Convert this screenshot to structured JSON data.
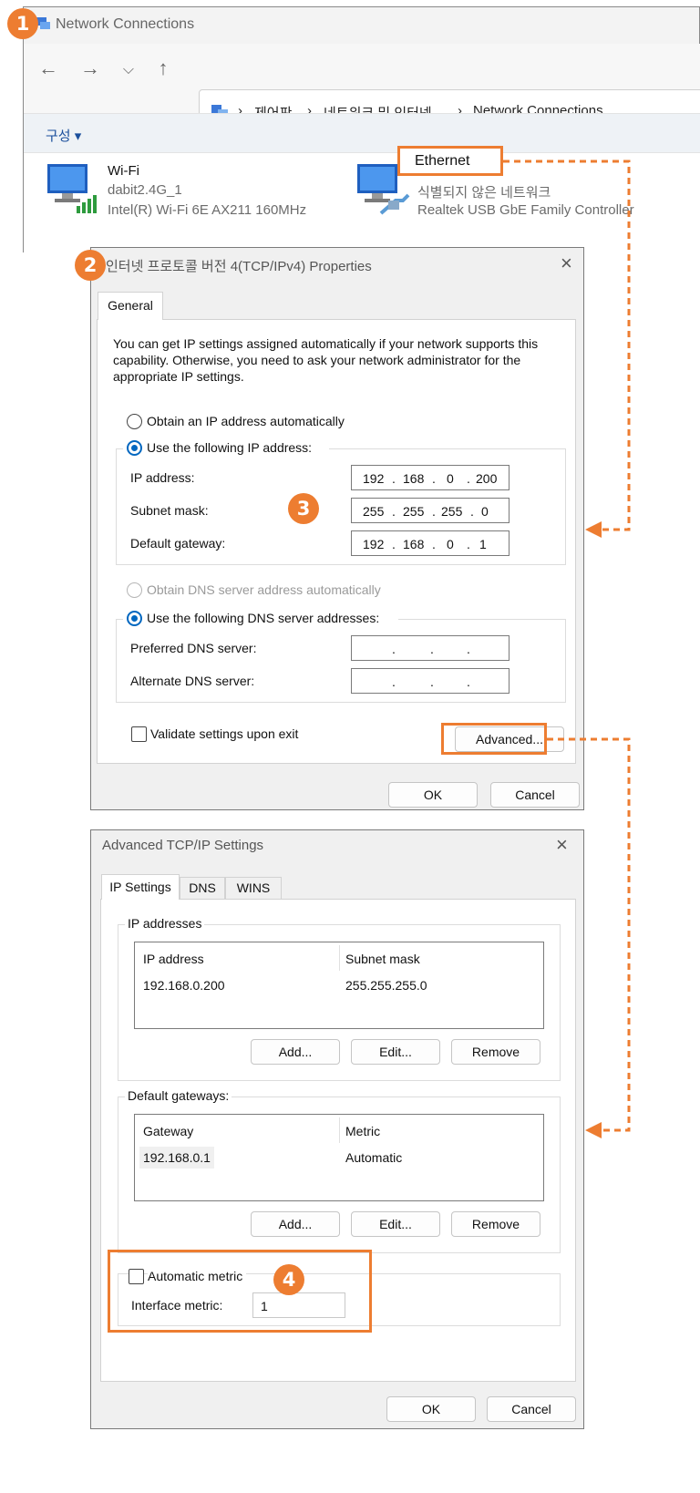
{
  "network_connections": {
    "title": "Network Connections",
    "breadcrumb": [
      "제어판",
      "네트워크 및 인터넷",
      "Network Connections"
    ],
    "organize_label": "구성 ▾",
    "adapters": [
      {
        "name": "Wi-Fi",
        "line1": "dabit2.4G_1",
        "line2": "Intel(R) Wi-Fi 6E AX211 160MHz"
      },
      {
        "name": "Ethernet",
        "line1": "식별되지 않은 네트워크",
        "line2": "Realtek USB GbE Family Controller"
      }
    ]
  },
  "badges": [
    "1",
    "2",
    "3",
    "4"
  ],
  "ipv4_dialog": {
    "title": "인터넷 프로토콜 버전 4(TCP/IPv4) Properties",
    "tab": "General",
    "description": "You can get IP settings assigned automatically if your network supports this capability. Otherwise, you need to ask your network administrator for the appropriate IP settings.",
    "radio_auto_ip": "Obtain an IP address automatically",
    "radio_manual_ip": "Use the following IP address:",
    "ip_label": "IP address:",
    "subnet_label": "Subnet mask:",
    "gateway_label": "Default gateway:",
    "ip": [
      "192",
      "168",
      "0",
      "200"
    ],
    "subnet": [
      "255",
      "255",
      "255",
      "0"
    ],
    "gateway": [
      "192",
      "168",
      "0",
      "1"
    ],
    "radio_auto_dns": "Obtain DNS server address automatically",
    "radio_manual_dns": "Use the following DNS server addresses:",
    "preferred_dns_label": "Preferred DNS server:",
    "alternate_dns_label": "Alternate DNS server:",
    "validate_label": "Validate settings upon exit",
    "advanced_label": "Advanced...",
    "ok_label": "OK",
    "cancel_label": "Cancel"
  },
  "advanced_dialog": {
    "title": "Advanced TCP/IP Settings",
    "tabs": [
      "IP Settings",
      "DNS",
      "WINS"
    ],
    "ip_group_label": "IP addresses",
    "ip_col1": "IP address",
    "ip_col2": "Subnet mask",
    "ip_row": {
      "ip": "192.168.0.200",
      "mask": "255.255.255.0"
    },
    "gw_group_label": "Default gateways:",
    "gw_col1": "Gateway",
    "gw_col2": "Metric",
    "gw_row": {
      "gateway": "192.168.0.1",
      "metric": "Automatic"
    },
    "add_label": "Add...",
    "edit_label": "Edit...",
    "remove_label": "Remove",
    "auto_metric_label": "Automatic metric",
    "interface_metric_label": "Interface metric:",
    "interface_metric_value": "1",
    "ok_label": "OK",
    "cancel_label": "Cancel"
  },
  "colors": {
    "accent": "#ed7d31",
    "radio": "#0067c0"
  }
}
